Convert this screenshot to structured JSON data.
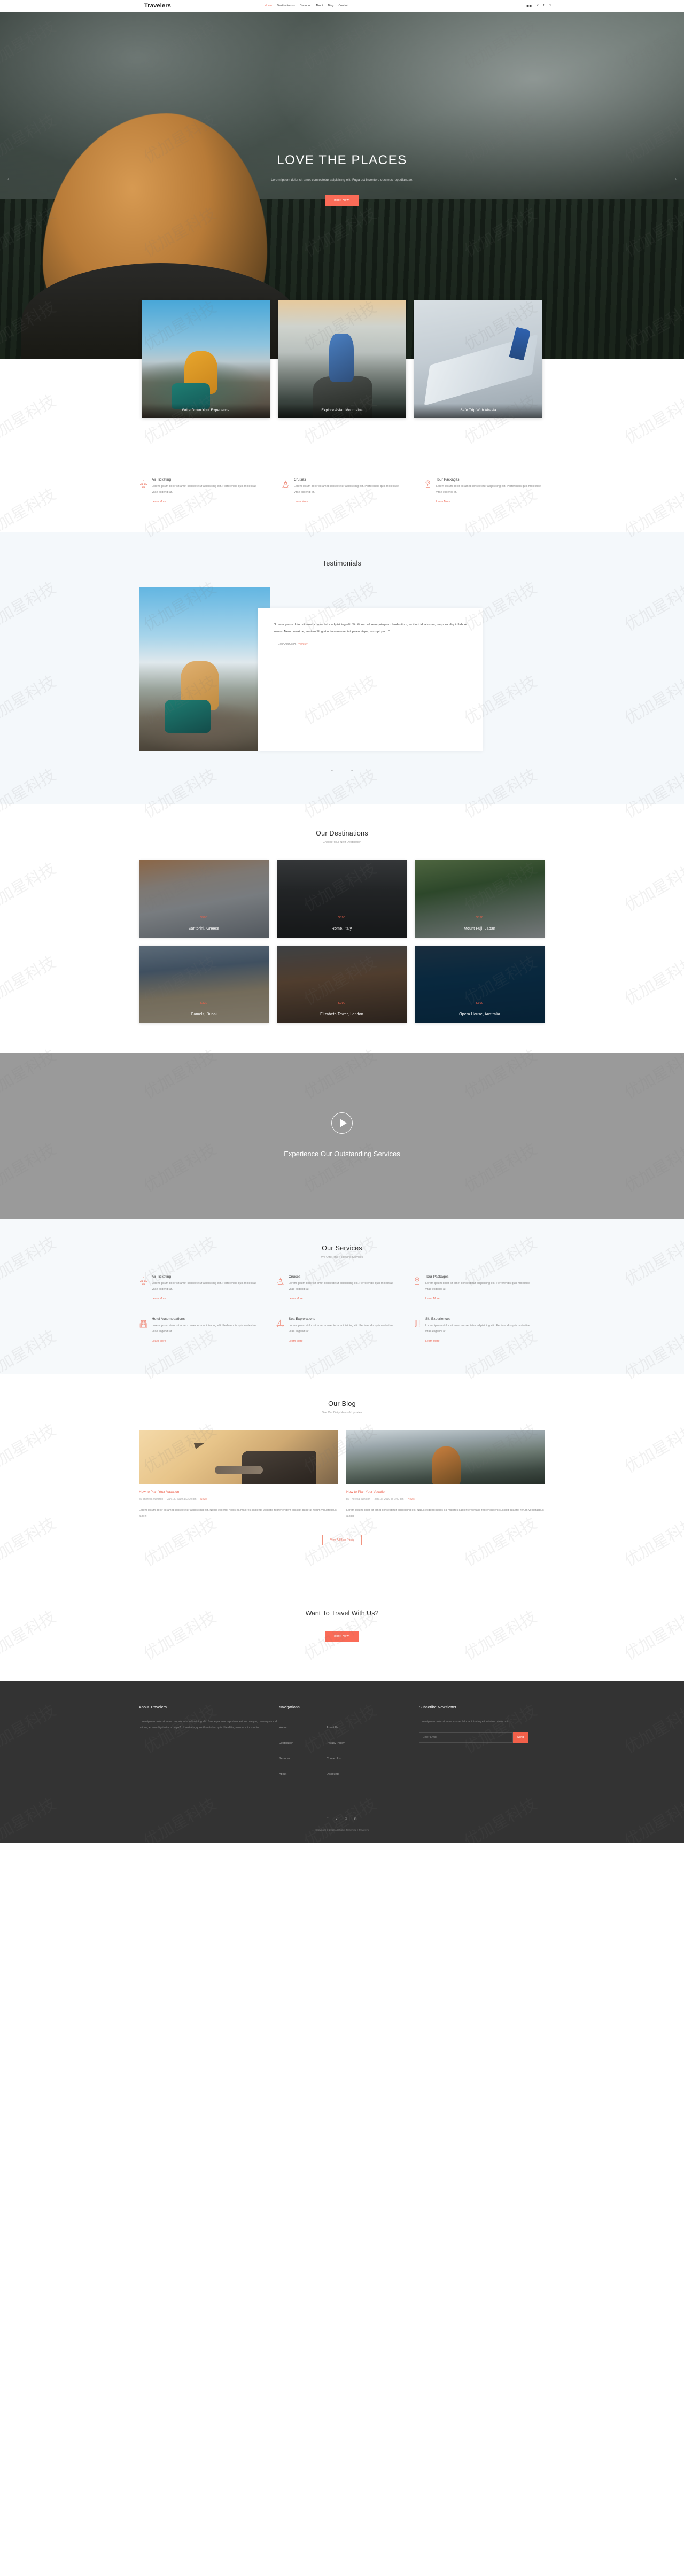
{
  "colors": {
    "accent": "#ef6a57",
    "accent_button": "#fa6b57",
    "footer_bg": "#333333",
    "light_band": "#f4f8fb"
  },
  "navbar": {
    "brand": "Travelers",
    "links": [
      {
        "label": "Home",
        "active": true
      },
      {
        "label": "Destinations",
        "active": false,
        "has_dropdown": true
      },
      {
        "label": "Discount",
        "active": false
      },
      {
        "label": "About",
        "active": false
      },
      {
        "label": "Blog",
        "active": false
      },
      {
        "label": "Contact",
        "active": false
      }
    ],
    "socials": [
      "flickr-icon",
      "twitter-icon",
      "facebook-icon",
      "instagram-icon"
    ],
    "social_glyphs": [
      "◉◉",
      "ᴠ",
      "f",
      "□"
    ]
  },
  "hero": {
    "title": "LOVE THE PLACES",
    "subtitle": "Lorem ipsum dolor sit amet consectetur adipisicing elit. Fuga est inventore ducimus repudiandae.",
    "button": "Book Now!",
    "prev": "‹",
    "next": "›"
  },
  "feature_cards": [
    {
      "caption": "Write Down Your Experience"
    },
    {
      "caption": "Explore Asian Mountains"
    },
    {
      "caption": "Safe Trip With Airasia"
    }
  ],
  "services_top": [
    {
      "icon": "airplane-icon",
      "title": "Air Ticketing",
      "body": "Lorem ipsum dolor sit amet consectetur adipisicing elit. Perferendis quis molestiae vitae eligendi at.",
      "link": "Learn More"
    },
    {
      "icon": "ship-icon",
      "title": "Cruises",
      "body": "Lorem ipsum dolor sit amet consectetur adipisicing elit. Perferendis quis molestiae vitae eligendi at.",
      "link": "Learn More"
    },
    {
      "icon": "map-pin-icon",
      "title": "Tour Packages",
      "body": "Lorem ipsum dolor sit amet consectetur adipisicing elit. Perferendis quis molestiae vitae eligendi at.",
      "link": "Learn More"
    }
  ],
  "testimonials": {
    "title": "Testimonials",
    "quote": "“Lorem ipsum dolor sit amet, consectetur adipisicing elit. Similique dolorem quisquam laudantium, incidunt id laborum, tempora aliquid labore minus. Nemo maxime, veniam! Fugiat odio nam eveniet ipsam atque, corrupti porro”",
    "author_dash": "— Clair Augustin,",
    "author_role": "Traveler",
    "prev": "←",
    "next": "→"
  },
  "destinations": {
    "title": "Our Destinations",
    "subtitle": "Choose Your Next Destination",
    "items": [
      {
        "price": "$590",
        "name": "Santorini, Greece"
      },
      {
        "price": "$390",
        "name": "Rome, Italy"
      },
      {
        "price": "$390",
        "name": "Mount Fuji, Japan"
      },
      {
        "price": "$320",
        "name": "Camels, Dubai"
      },
      {
        "price": "$290",
        "name": "Elizabeth Tower, London"
      },
      {
        "price": "$390",
        "name": "Opera House, Australia"
      }
    ]
  },
  "video": {
    "play_icon": "play-icon",
    "title": "Experience Our Outstanding Services"
  },
  "services": {
    "title": "Our Services",
    "subtitle": "We Offer The Following Services",
    "items": [
      {
        "icon": "airplane-icon",
        "title": "Air Ticketing",
        "body": "Lorem ipsum dolor sit amet consectetur adipisicing elit. Perferendis quis molestiae vitae eligendi at.",
        "link": "Learn More"
      },
      {
        "icon": "ship-icon",
        "title": "Cruises",
        "body": "Lorem ipsum dolor sit amet consectetur adipisicing elit. Perferendis quis molestiae vitae eligendi at.",
        "link": "Learn More"
      },
      {
        "icon": "map-pin-icon",
        "title": "Tour Packages",
        "body": "Lorem ipsum dolor sit amet consectetur adipisicing elit. Perferendis quis molestiae vitae eligendi at.",
        "link": "Learn More"
      },
      {
        "icon": "hotel-icon",
        "title": "Hotel Accomodations",
        "body": "Lorem ipsum dolor sit amet consectetur adipisicing elit. Perferendis quis molestiae vitae eligendi at.",
        "link": "Learn More"
      },
      {
        "icon": "sailboat-icon",
        "title": "Sea Explorations",
        "body": "Lorem ipsum dolor sit amet consectetur adipisicing elit. Perferendis quis molestiae vitae eligendi at.",
        "link": "Learn More"
      },
      {
        "icon": "skis-icon",
        "title": "Ski Experiences",
        "body": "Lorem ipsum dolor sit amet consectetur adipisicing elit. Perferendis quis molestiae vitae eligendi at.",
        "link": "Learn More"
      }
    ]
  },
  "blog": {
    "title": "Our Blog",
    "subtitle": "See Our Daily News & Updates",
    "posts": [
      {
        "title": "How to Plan Your Vacation",
        "author": "by Theresa Winston",
        "date": "Jan 18, 2019 at 2:00 pm",
        "category": "News",
        "excerpt": "Lorem ipsum dolor sit amet consectetur adipisicing elit. Natus eligendi nobis ea maiores sapiente veritatis reprehenderit suscipit quaerat rerum voluptatibus a eius."
      },
      {
        "title": "How to Plan Your Vacation",
        "author": "by Theresa Winston",
        "date": "Jan 18, 2019 at 2:00 pm",
        "category": "News",
        "excerpt": "Lorem ipsum dolor sit amet consectetur adipisicing elit. Natus eligendi nobis ea maiores sapiente veritatis reprehenderit suscipit quaerat rerum voluptatibus a eius."
      }
    ],
    "button": "View All Blog Posts"
  },
  "cta": {
    "title": "Want To Travel With Us?",
    "button": "Book Now!"
  },
  "footer": {
    "about_title": "About Travelers",
    "about_body": "Lorem ipsum dolor sit amet, consectetur adipisicing elit. Saepe pariatur reprehenderit vero atque, consequatur id ratione, et non dignissimos culpa? Ut veritatis, quos illum totam quis blanditiis, minima minus odio!",
    "nav_title": "Navigations",
    "nav_col1": [
      "Home",
      "Destination",
      "Services",
      "About"
    ],
    "nav_col2": [
      "About Us",
      "Privacy Policy",
      "Contact Us",
      "Discounts"
    ],
    "sub_title": "Subscribe Newsletter",
    "sub_body": "Lorem ipsum dolor sit amet consectetur adipisicing elit minima minus odio.",
    "sub_placeholder": "Enter Email",
    "sub_button": "Send",
    "socials": [
      "facebook-icon",
      "twitter-icon",
      "instagram-icon",
      "linkedin-icon"
    ],
    "social_glyphs": [
      "f",
      "ᴠ",
      "□",
      "in"
    ],
    "copyright_pre": "Copyright © 2019 All Rights Reserved |  Travelers"
  },
  "watermark": {
    "text": "优加星科技"
  }
}
